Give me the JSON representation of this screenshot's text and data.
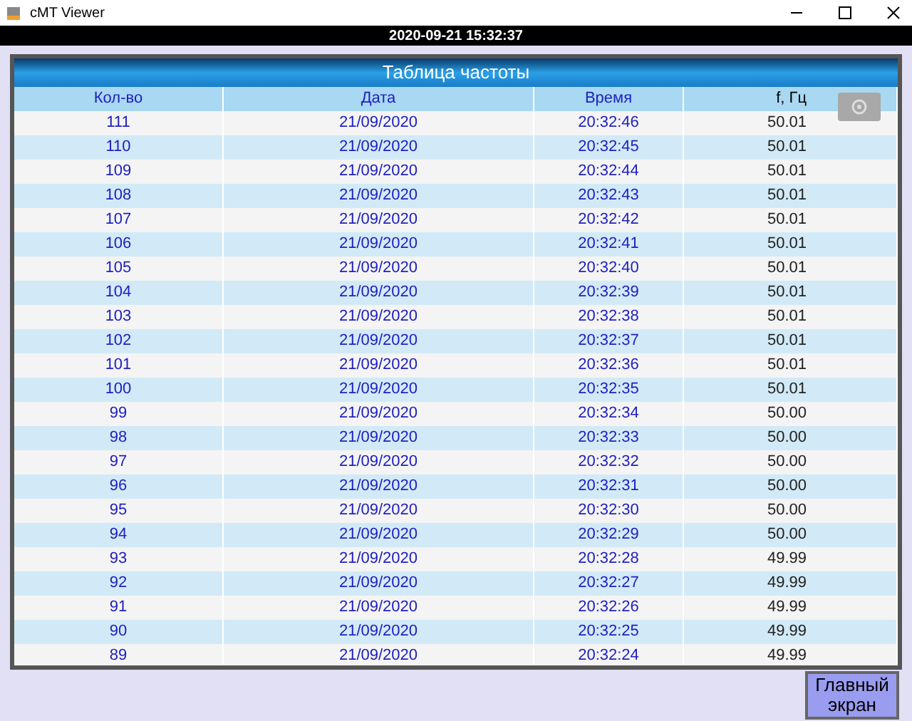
{
  "window": {
    "title": "cMT Viewer"
  },
  "clock": "2020-09-21 15:32:37",
  "table": {
    "title": "Таблица частоты",
    "columns": [
      "Кол-во",
      "Дата",
      "Время",
      "f, Гц"
    ],
    "rows": [
      [
        "111",
        "21/09/2020",
        "20:32:46",
        "50.01"
      ],
      [
        "110",
        "21/09/2020",
        "20:32:45",
        "50.01"
      ],
      [
        "109",
        "21/09/2020",
        "20:32:44",
        "50.01"
      ],
      [
        "108",
        "21/09/2020",
        "20:32:43",
        "50.01"
      ],
      [
        "107",
        "21/09/2020",
        "20:32:42",
        "50.01"
      ],
      [
        "106",
        "21/09/2020",
        "20:32:41",
        "50.01"
      ],
      [
        "105",
        "21/09/2020",
        "20:32:40",
        "50.01"
      ],
      [
        "104",
        "21/09/2020",
        "20:32:39",
        "50.01"
      ],
      [
        "103",
        "21/09/2020",
        "20:32:38",
        "50.01"
      ],
      [
        "102",
        "21/09/2020",
        "20:32:37",
        "50.01"
      ],
      [
        "101",
        "21/09/2020",
        "20:32:36",
        "50.01"
      ],
      [
        "100",
        "21/09/2020",
        "20:32:35",
        "50.01"
      ],
      [
        "99",
        "21/09/2020",
        "20:32:34",
        "50.00"
      ],
      [
        "98",
        "21/09/2020",
        "20:32:33",
        "50.00"
      ],
      [
        "97",
        "21/09/2020",
        "20:32:32",
        "50.00"
      ],
      [
        "96",
        "21/09/2020",
        "20:32:31",
        "50.00"
      ],
      [
        "95",
        "21/09/2020",
        "20:32:30",
        "50.00"
      ],
      [
        "94",
        "21/09/2020",
        "20:32:29",
        "50.00"
      ],
      [
        "93",
        "21/09/2020",
        "20:32:28",
        "49.99"
      ],
      [
        "92",
        "21/09/2020",
        "20:32:27",
        "49.99"
      ],
      [
        "91",
        "21/09/2020",
        "20:32:26",
        "49.99"
      ],
      [
        "90",
        "21/09/2020",
        "20:32:25",
        "49.99"
      ],
      [
        "89",
        "21/09/2020",
        "20:32:24",
        "49.99"
      ]
    ]
  },
  "main_button": "Главный экран"
}
